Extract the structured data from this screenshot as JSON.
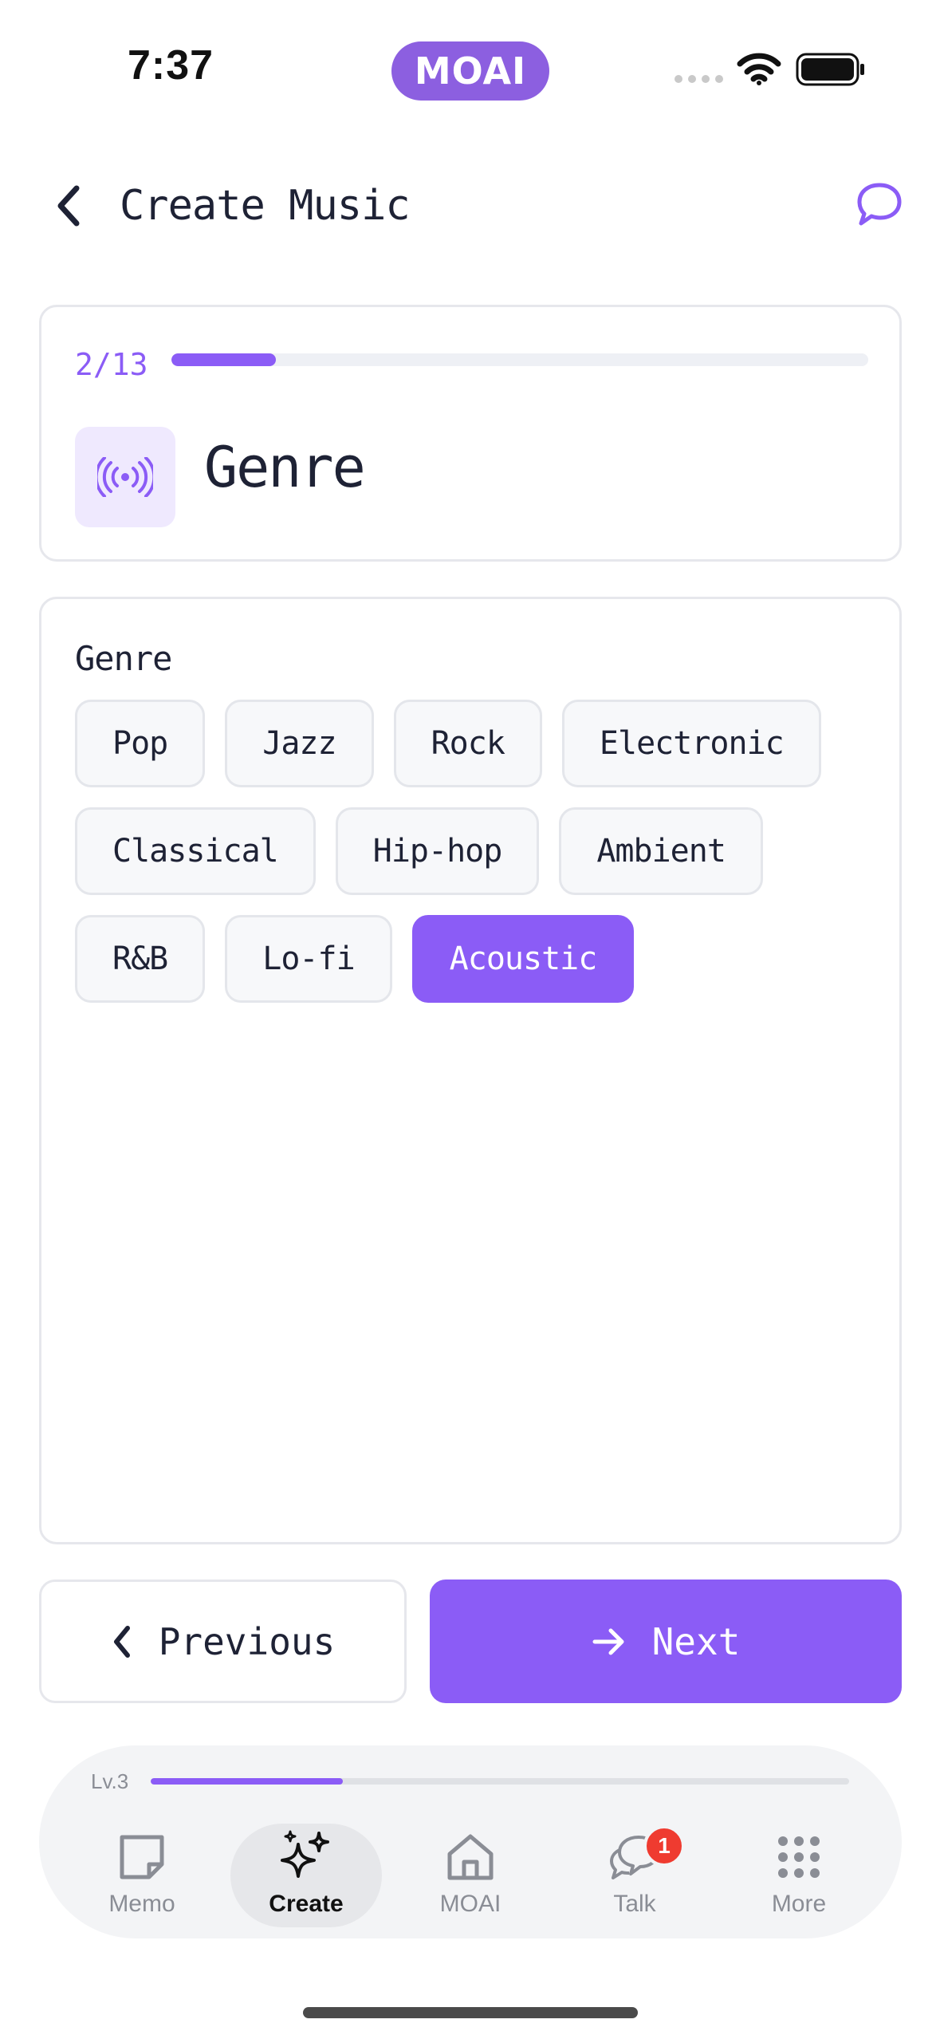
{
  "status_bar": {
    "time": "7:37",
    "app_pill": "MOAI"
  },
  "header": {
    "title": "Create Music"
  },
  "step": {
    "counter": "2/13",
    "progress": 0.15,
    "title": "Genre",
    "icon": "broadcast-icon"
  },
  "genre": {
    "label": "Genre",
    "options": [
      "Pop",
      "Jazz",
      "Rock",
      "Electronic",
      "Classical",
      "Hip-hop",
      "Ambient",
      "R&B",
      "Lo-fi",
      "Acoustic"
    ],
    "selected": "Acoustic"
  },
  "nav": {
    "previous_label": "Previous",
    "next_label": "Next"
  },
  "tabbar": {
    "level_label": "Lv.3",
    "level_progress": 0.275,
    "tabs": [
      {
        "label": "Memo",
        "icon": "memo-icon"
      },
      {
        "label": "Create",
        "icon": "sparkle-icon",
        "active": true
      },
      {
        "label": "MOAI",
        "icon": "home-icon"
      },
      {
        "label": "Talk",
        "icon": "talk-icon",
        "badge": "1"
      },
      {
        "label": "More",
        "icon": "grid-icon"
      }
    ]
  },
  "colors": {
    "accent": "#8b5cf6",
    "badge": "#ef3b30",
    "text": "#1e2235"
  }
}
